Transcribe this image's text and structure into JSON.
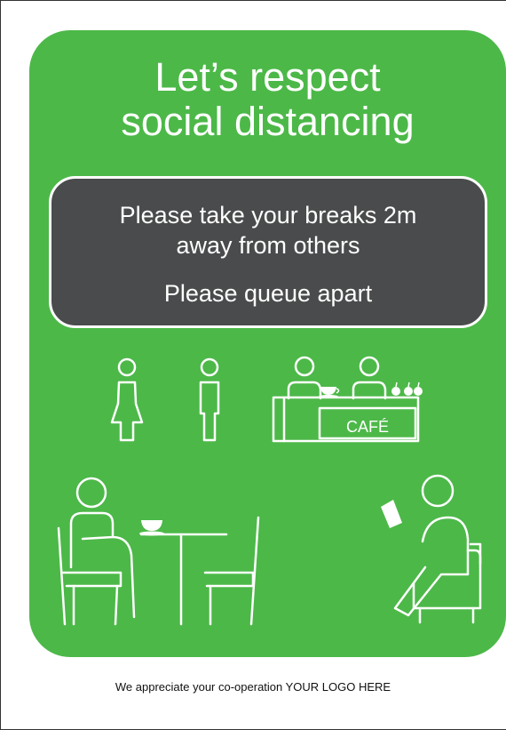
{
  "poster": {
    "headline_lines": [
      "Let’s respect",
      "social distancing"
    ],
    "message_lines": [
      "Please take your breaks 2m",
      "away from others"
    ],
    "queue_message": "Please queue apart",
    "counter_sign": "CAFÉ",
    "colors": {
      "background": "#4cb848",
      "message_box": "#4a4b4c",
      "foreground": "#ffffff"
    },
    "icons": [
      "woman-icon",
      "man-icon",
      "cafe-counter-icon",
      "coffee-cup-icon",
      "apples-icon",
      "seated-person-at-table-icon",
      "person-reading-in-armchair-icon"
    ]
  },
  "footer": {
    "text": "We appreciate your co-operation YOUR LOGO HERE"
  }
}
